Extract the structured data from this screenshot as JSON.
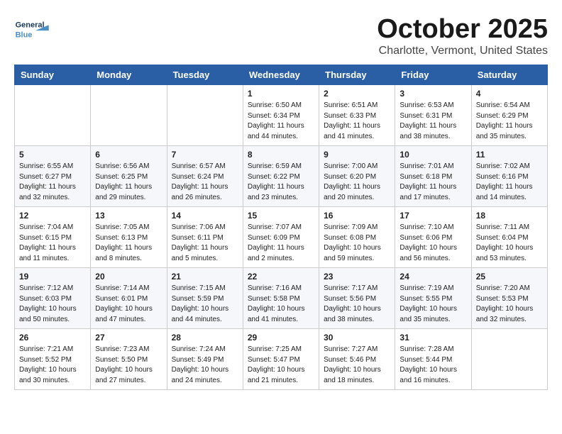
{
  "header": {
    "logo_line1": "General",
    "logo_line2": "Blue",
    "month": "October 2025",
    "location": "Charlotte, Vermont, United States"
  },
  "weekdays": [
    "Sunday",
    "Monday",
    "Tuesday",
    "Wednesday",
    "Thursday",
    "Friday",
    "Saturday"
  ],
  "weeks": [
    [
      {
        "day": "",
        "info": ""
      },
      {
        "day": "",
        "info": ""
      },
      {
        "day": "",
        "info": ""
      },
      {
        "day": "1",
        "info": "Sunrise: 6:50 AM\nSunset: 6:34 PM\nDaylight: 11 hours\nand 44 minutes."
      },
      {
        "day": "2",
        "info": "Sunrise: 6:51 AM\nSunset: 6:33 PM\nDaylight: 11 hours\nand 41 minutes."
      },
      {
        "day": "3",
        "info": "Sunrise: 6:53 AM\nSunset: 6:31 PM\nDaylight: 11 hours\nand 38 minutes."
      },
      {
        "day": "4",
        "info": "Sunrise: 6:54 AM\nSunset: 6:29 PM\nDaylight: 11 hours\nand 35 minutes."
      }
    ],
    [
      {
        "day": "5",
        "info": "Sunrise: 6:55 AM\nSunset: 6:27 PM\nDaylight: 11 hours\nand 32 minutes."
      },
      {
        "day": "6",
        "info": "Sunrise: 6:56 AM\nSunset: 6:25 PM\nDaylight: 11 hours\nand 29 minutes."
      },
      {
        "day": "7",
        "info": "Sunrise: 6:57 AM\nSunset: 6:24 PM\nDaylight: 11 hours\nand 26 minutes."
      },
      {
        "day": "8",
        "info": "Sunrise: 6:59 AM\nSunset: 6:22 PM\nDaylight: 11 hours\nand 23 minutes."
      },
      {
        "day": "9",
        "info": "Sunrise: 7:00 AM\nSunset: 6:20 PM\nDaylight: 11 hours\nand 20 minutes."
      },
      {
        "day": "10",
        "info": "Sunrise: 7:01 AM\nSunset: 6:18 PM\nDaylight: 11 hours\nand 17 minutes."
      },
      {
        "day": "11",
        "info": "Sunrise: 7:02 AM\nSunset: 6:16 PM\nDaylight: 11 hours\nand 14 minutes."
      }
    ],
    [
      {
        "day": "12",
        "info": "Sunrise: 7:04 AM\nSunset: 6:15 PM\nDaylight: 11 hours\nand 11 minutes."
      },
      {
        "day": "13",
        "info": "Sunrise: 7:05 AM\nSunset: 6:13 PM\nDaylight: 11 hours\nand 8 minutes."
      },
      {
        "day": "14",
        "info": "Sunrise: 7:06 AM\nSunset: 6:11 PM\nDaylight: 11 hours\nand 5 minutes."
      },
      {
        "day": "15",
        "info": "Sunrise: 7:07 AM\nSunset: 6:09 PM\nDaylight: 11 hours\nand 2 minutes."
      },
      {
        "day": "16",
        "info": "Sunrise: 7:09 AM\nSunset: 6:08 PM\nDaylight: 10 hours\nand 59 minutes."
      },
      {
        "day": "17",
        "info": "Sunrise: 7:10 AM\nSunset: 6:06 PM\nDaylight: 10 hours\nand 56 minutes."
      },
      {
        "day": "18",
        "info": "Sunrise: 7:11 AM\nSunset: 6:04 PM\nDaylight: 10 hours\nand 53 minutes."
      }
    ],
    [
      {
        "day": "19",
        "info": "Sunrise: 7:12 AM\nSunset: 6:03 PM\nDaylight: 10 hours\nand 50 minutes."
      },
      {
        "day": "20",
        "info": "Sunrise: 7:14 AM\nSunset: 6:01 PM\nDaylight: 10 hours\nand 47 minutes."
      },
      {
        "day": "21",
        "info": "Sunrise: 7:15 AM\nSunset: 5:59 PM\nDaylight: 10 hours\nand 44 minutes."
      },
      {
        "day": "22",
        "info": "Sunrise: 7:16 AM\nSunset: 5:58 PM\nDaylight: 10 hours\nand 41 minutes."
      },
      {
        "day": "23",
        "info": "Sunrise: 7:17 AM\nSunset: 5:56 PM\nDaylight: 10 hours\nand 38 minutes."
      },
      {
        "day": "24",
        "info": "Sunrise: 7:19 AM\nSunset: 5:55 PM\nDaylight: 10 hours\nand 35 minutes."
      },
      {
        "day": "25",
        "info": "Sunrise: 7:20 AM\nSunset: 5:53 PM\nDaylight: 10 hours\nand 32 minutes."
      }
    ],
    [
      {
        "day": "26",
        "info": "Sunrise: 7:21 AM\nSunset: 5:52 PM\nDaylight: 10 hours\nand 30 minutes."
      },
      {
        "day": "27",
        "info": "Sunrise: 7:23 AM\nSunset: 5:50 PM\nDaylight: 10 hours\nand 27 minutes."
      },
      {
        "day": "28",
        "info": "Sunrise: 7:24 AM\nSunset: 5:49 PM\nDaylight: 10 hours\nand 24 minutes."
      },
      {
        "day": "29",
        "info": "Sunrise: 7:25 AM\nSunset: 5:47 PM\nDaylight: 10 hours\nand 21 minutes."
      },
      {
        "day": "30",
        "info": "Sunrise: 7:27 AM\nSunset: 5:46 PM\nDaylight: 10 hours\nand 18 minutes."
      },
      {
        "day": "31",
        "info": "Sunrise: 7:28 AM\nSunset: 5:44 PM\nDaylight: 10 hours\nand 16 minutes."
      },
      {
        "day": "",
        "info": ""
      }
    ]
  ]
}
